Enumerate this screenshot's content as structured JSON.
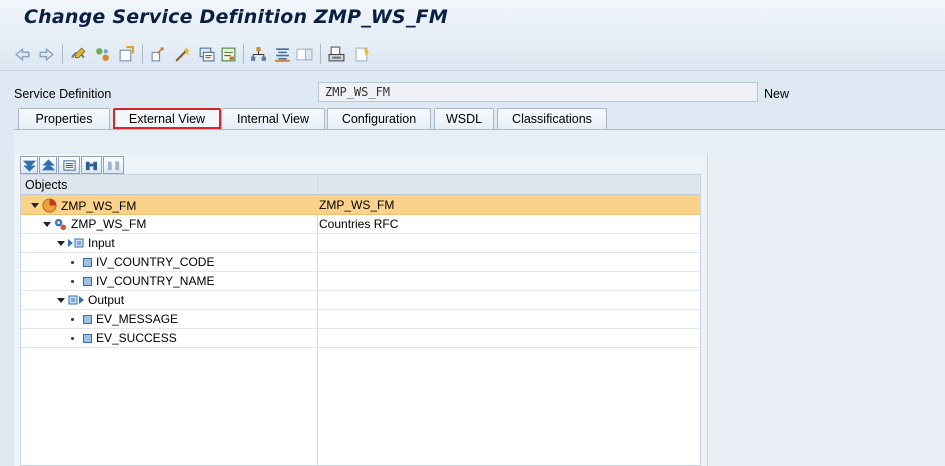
{
  "window": {
    "title": "Change Service Definition ZMP_WS_FM"
  },
  "toolbar": {
    "icons": [
      "back-icon",
      "forward-icon",
      "display-change-icon",
      "other-object-icon",
      "activate-icon",
      "check-icon",
      "where-used-icon",
      "wand-icon",
      "display-object-icon",
      "navigation-icon",
      "hierarchy-icon",
      "list-icon",
      "panel-icon",
      "print-icon",
      "info-icon"
    ]
  },
  "service": {
    "label": "Service Definition",
    "value": "ZMP_WS_FM",
    "status": "New"
  },
  "tabs": [
    {
      "label": "Properties",
      "active": false
    },
    {
      "label": "External View",
      "active": true
    },
    {
      "label": "Internal View",
      "active": false
    },
    {
      "label": "Configuration",
      "active": false
    },
    {
      "label": "WSDL",
      "active": false
    },
    {
      "label": "Classifications",
      "active": false
    }
  ],
  "tree": {
    "toolbar_icons": [
      "expand-all-icon",
      "collapse-all-icon",
      "detail-icon",
      "find-icon",
      "find-next-icon"
    ],
    "columns": [
      "Objects",
      ""
    ],
    "rows": [
      {
        "name": "ZMP_WS_FM",
        "value": "ZMP_WS_FM",
        "icon": "service-icon",
        "selected": true
      },
      {
        "name": "ZMP_WS_FM",
        "value": "Countries RFC",
        "icon": "function-module-icon",
        "selected": false
      },
      {
        "name": "Input",
        "value": "",
        "icon": "input-icon",
        "selected": false
      },
      {
        "name": "IV_COUNTRY_CODE",
        "value": "",
        "icon": "parameter-icon",
        "selected": false
      },
      {
        "name": "IV_COUNTRY_NAME",
        "value": "",
        "icon": "parameter-icon",
        "selected": false
      },
      {
        "name": "Output",
        "value": "",
        "icon": "output-icon",
        "selected": false
      },
      {
        "name": "EV_MESSAGE",
        "value": "",
        "icon": "parameter-icon",
        "selected": false
      },
      {
        "name": "EV_SUCCESS",
        "value": "",
        "icon": "parameter-icon",
        "selected": false
      }
    ]
  },
  "colors": {
    "selected_row": "#fbd28a",
    "active_tab_border": "#d9262b",
    "background": "#dfe9f3"
  }
}
